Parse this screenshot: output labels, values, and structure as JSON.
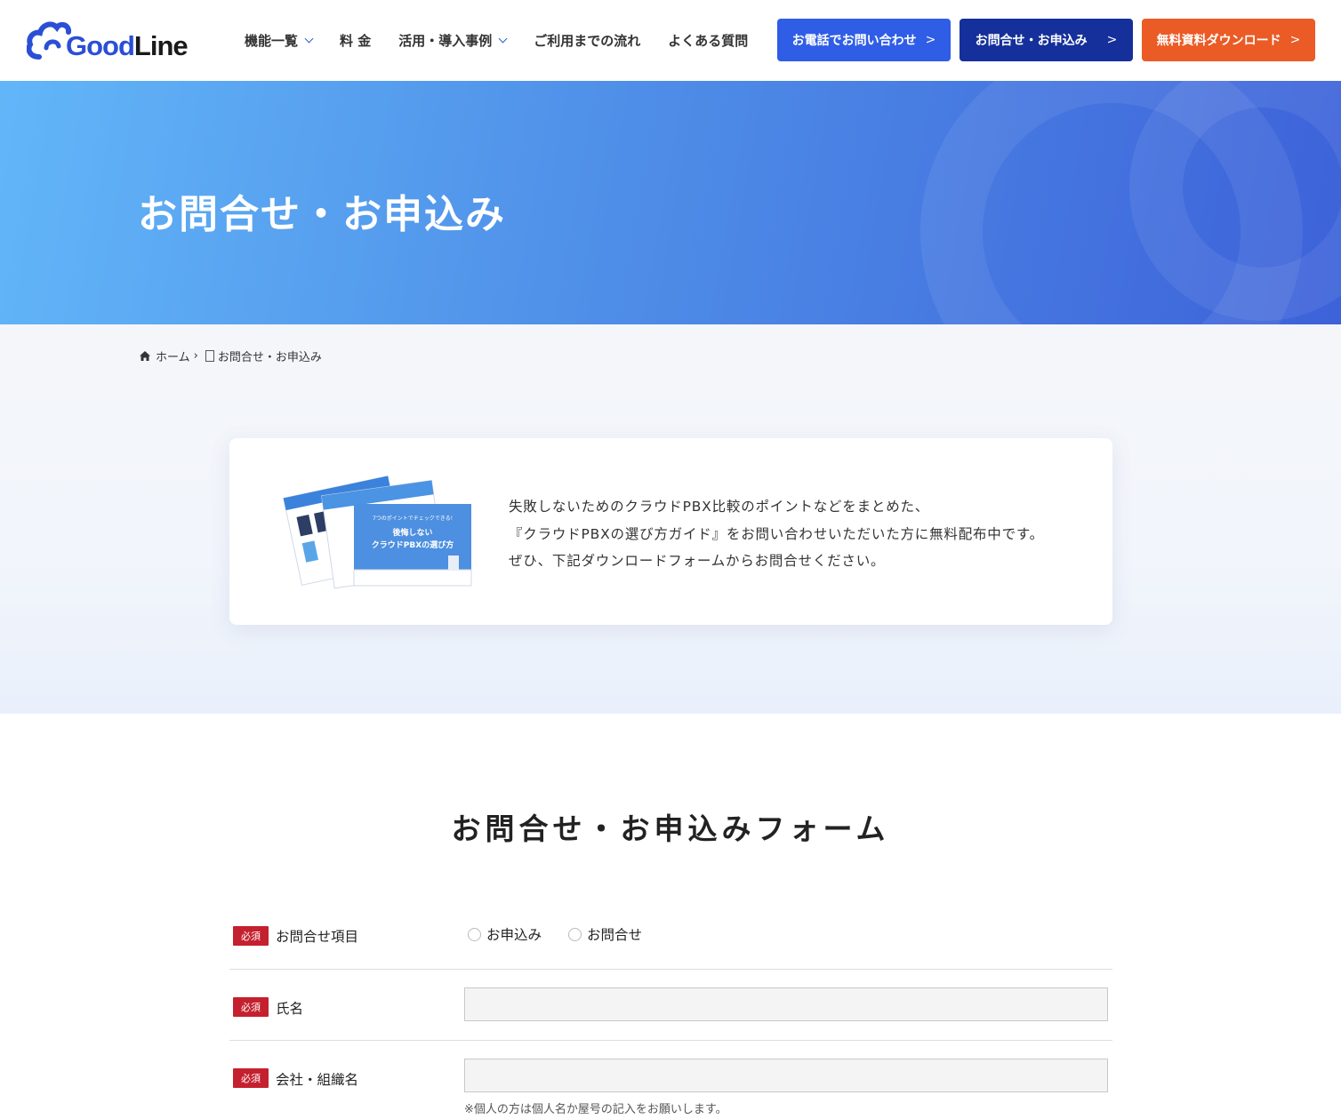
{
  "header": {
    "logo": {
      "good": "Good",
      "line": "Line"
    },
    "nav": [
      {
        "label": "機能一覧",
        "has_dropdown": true
      },
      {
        "label": "料 金",
        "has_dropdown": false
      },
      {
        "label": "活用・導入事例",
        "has_dropdown": true
      },
      {
        "label": "ご利用までの流れ",
        "has_dropdown": false
      },
      {
        "label": "よくある質問",
        "has_dropdown": false
      }
    ],
    "buttons": {
      "phone": "お電話でお問い合わせ",
      "contact": "お問合せ・お申込み",
      "download": "無料資料ダウンロード",
      "arrow": ">"
    }
  },
  "hero": {
    "title": "お問合せ・お申込み"
  },
  "breadcrumb": {
    "home": "ホーム",
    "separator": "›",
    "current": "お問合せ・お申込み"
  },
  "intro_card": {
    "lines": [
      "失敗しないためのクラウドPBX比較のポイントなどをまとめた、",
      "『クラウドPBXの選び方ガイド』をお問い合わせいただいた方に無料配布中です。",
      "ぜひ、下記ダウンロードフォームからお問合せください。"
    ],
    "brochure": {
      "kicker": "7つのポイントでチェックできる!",
      "title_line1": "後悔しない",
      "title_line2": "クラウドPBXの選び方"
    }
  },
  "form": {
    "title": "お問合せ・お申込みフォーム",
    "required_badge": "必須",
    "fields": {
      "inquiry_type": {
        "label": "お問合せ項目",
        "options": [
          "お申込み",
          "お問合せ"
        ]
      },
      "name": {
        "label": "氏名",
        "value": ""
      },
      "company": {
        "label": "会社・組織名",
        "value": "",
        "note": "※個人の方は個人名か屋号の記入をお願いします。"
      }
    }
  },
  "colors": {
    "brand_blue": "#2a4fd6",
    "phone_button": "#2f5de6",
    "contact_button": "#15309a",
    "download_button": "#ea5b26",
    "required_badge": "#c4202e"
  }
}
